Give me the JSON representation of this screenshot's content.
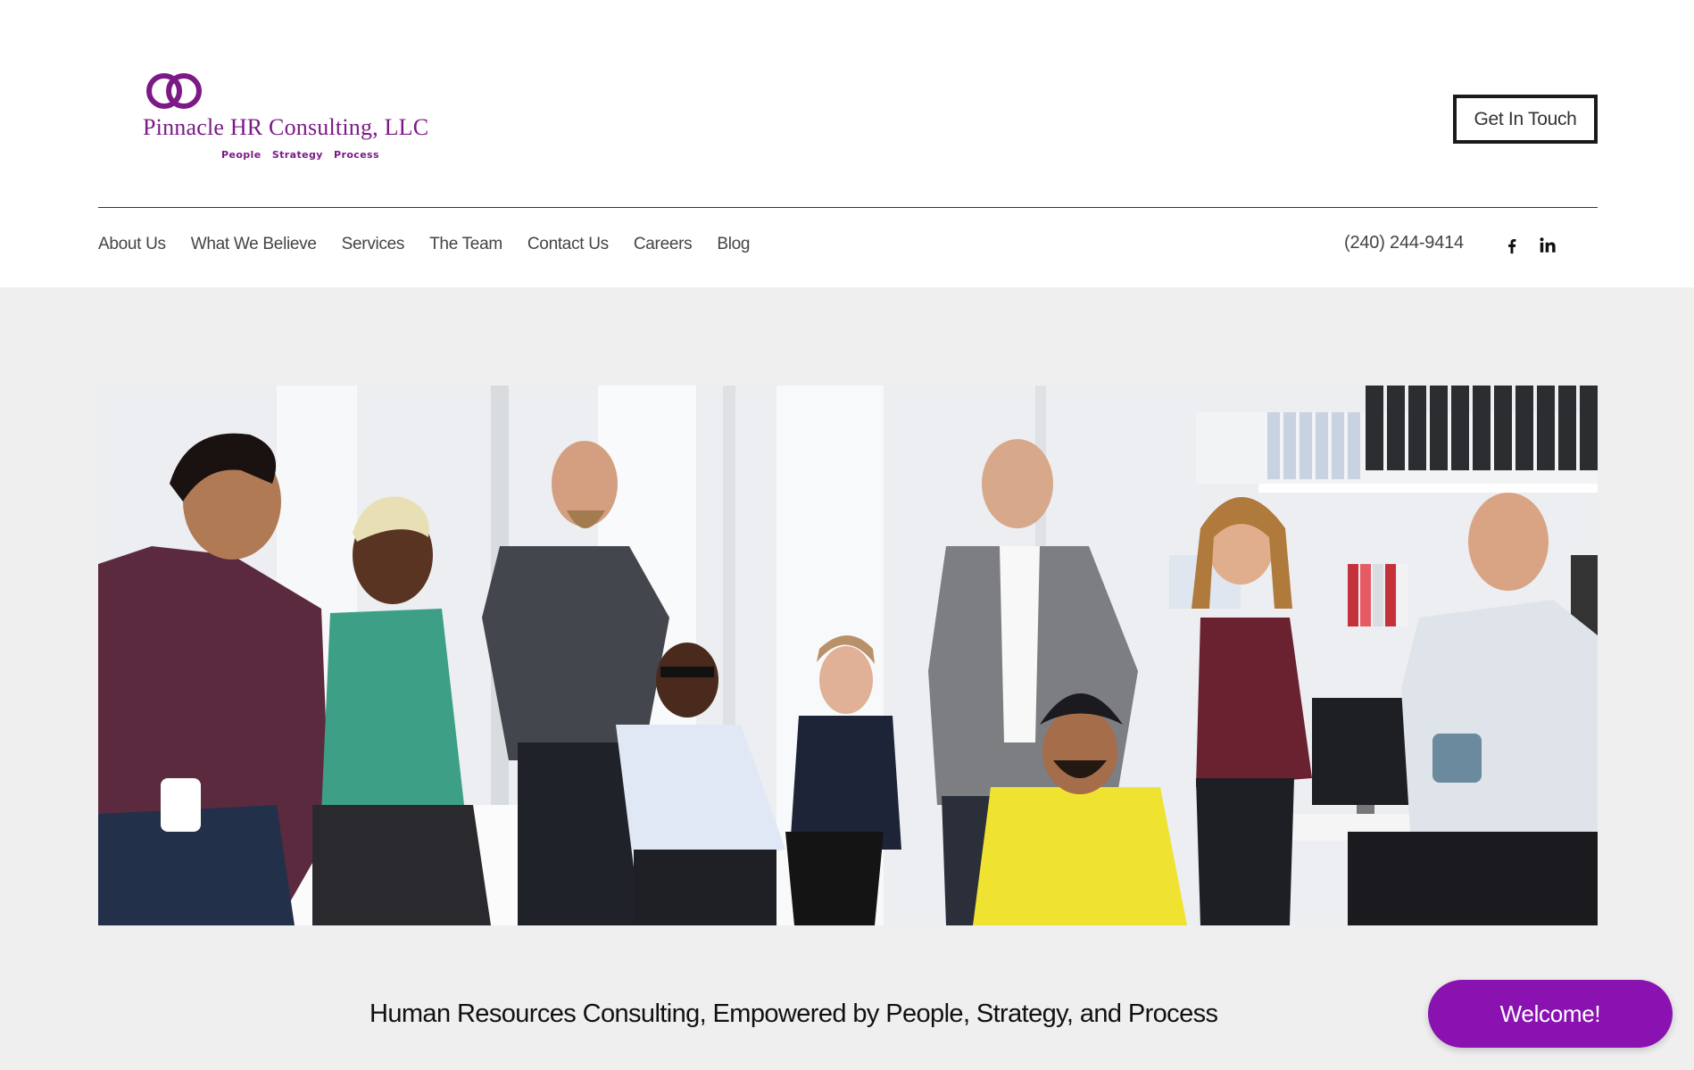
{
  "brand": {
    "name": "Pinnacle HR Consulting, LLC",
    "tagline": "People  Strategy  Process",
    "color": "#7b1a86"
  },
  "header": {
    "cta_label": "Get In Touch",
    "phone": "(240) 244-9414"
  },
  "nav": {
    "items": [
      {
        "label": "About Us"
      },
      {
        "label": "What We Believe"
      },
      {
        "label": "Services"
      },
      {
        "label": "The Team"
      },
      {
        "label": "Contact Us"
      },
      {
        "label": "Careers"
      },
      {
        "label": "Blog"
      }
    ]
  },
  "social": {
    "icons": [
      "facebook-icon",
      "linkedin-icon"
    ]
  },
  "hero": {
    "image_subject": "group photo of smiling team in bright office",
    "headline": "Human Resources Consulting, Empowered by People, Strategy, and Process"
  },
  "chat": {
    "welcome_label": "Welcome!",
    "accent": "#8a12b0"
  }
}
